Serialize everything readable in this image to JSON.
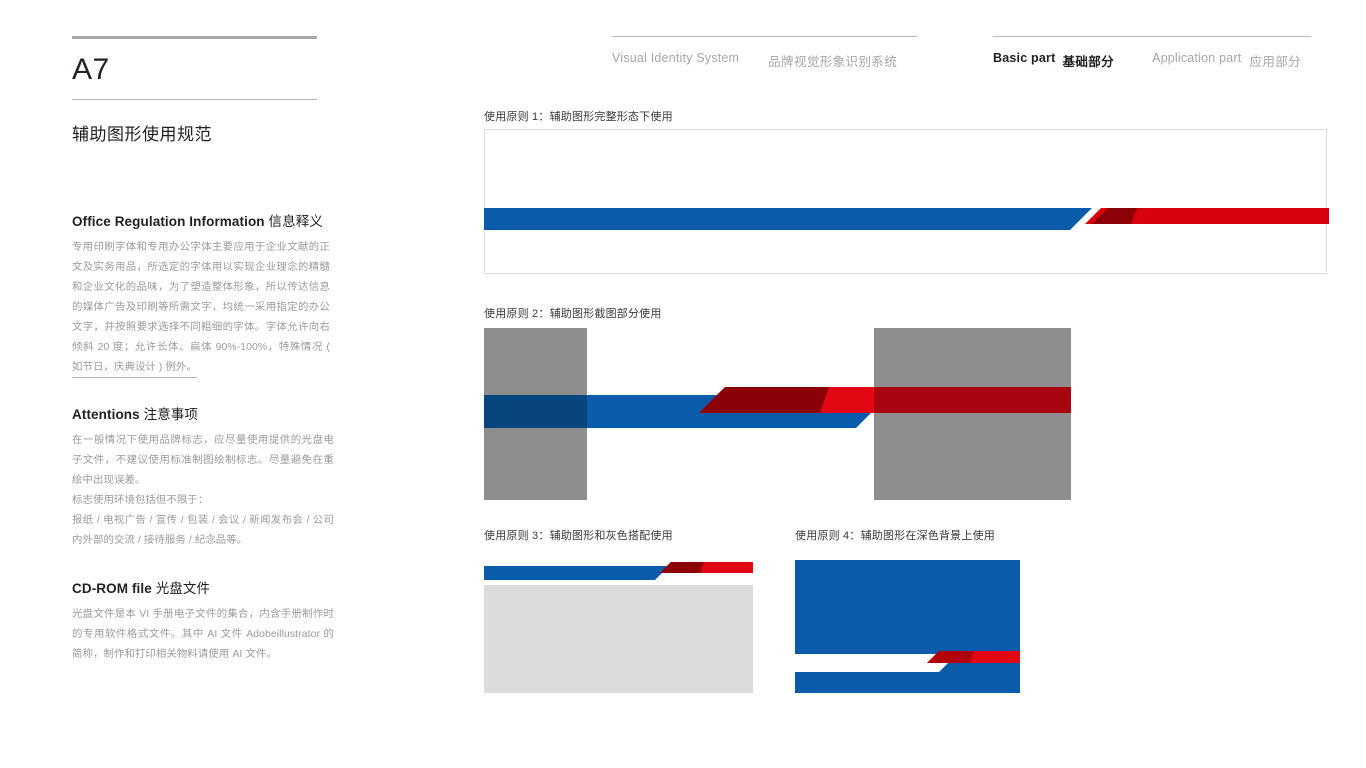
{
  "page": {
    "code": "A7",
    "section_title": "辅助图形使用规范"
  },
  "nav": {
    "left": {
      "en": "Visual Identity System",
      "cn": "品牌视觉形象识别系统"
    },
    "right": {
      "basic_en": "Basic part",
      "basic_cn": "基础部分",
      "application_en": "Application part",
      "application_cn": "应用部分"
    }
  },
  "blocks": {
    "office": {
      "head_en": "Office Regulation Information",
      "head_cn": "信息释义",
      "body": "专用印刷字体和专用办公字体主要应用于企业文献的正文及实务用品，所选定的字体用以实现企业理念的精髓和企业文化的品味，为了塑造整体形象，所以传达信息的媒体广告及印刷等所需文字，均统一采用指定的办公文字，并按照要求选择不同粗细的字体。字体允许向右倾斜 20 度；允许长体、扁体 90%-100%，特殊情况 ( 如节日，庆典设计 ) 例外。"
    },
    "attentions": {
      "head_en": "Attentions",
      "head_cn": "注意事项",
      "body_1": "在一般情况下使用品牌标志，应尽量使用提供的光盘电子文件，不建议使用标准制图绘制标志。尽量避免在重绘中出现误差。",
      "body_2": "标志使用环境包括但不限于：",
      "body_3": "报纸 / 电视广告 / 宣传 / 包装 / 会议 / 新闻发布会 / 公司内外部的交流 / 接待服务 / 纪念品等。"
    },
    "cdrom": {
      "head_en": "CD-ROM file",
      "head_cn": "光盘文件",
      "body": "光盘文件是本 VI 手册电子文件的集合，内含手册制作时的专用软件格式文件。其中 AI 文件 Adobeillustrator 的简称，制作和打印相关物料请使用 AI 文件。"
    }
  },
  "panels": {
    "rule_1": "使用原则 1：辅助图形完整形态下使用",
    "rule_2": "使用原则 2：辅助图形截图部分使用",
    "rule_3": "使用原则 3：辅助图形和灰色搭配使用",
    "rule_4": "使用原则 4：辅助图形在深色背景上使用"
  },
  "colors": {
    "brand_blue": "#0A5CAB",
    "brand_red": "#D9000F",
    "overlap_dark_red": "#8C0007",
    "gray_block": "#BEBEBE",
    "light_gray_block": "#DCDCDC",
    "text_dark": "#231F20",
    "text_muted": "#9B9B9B"
  }
}
